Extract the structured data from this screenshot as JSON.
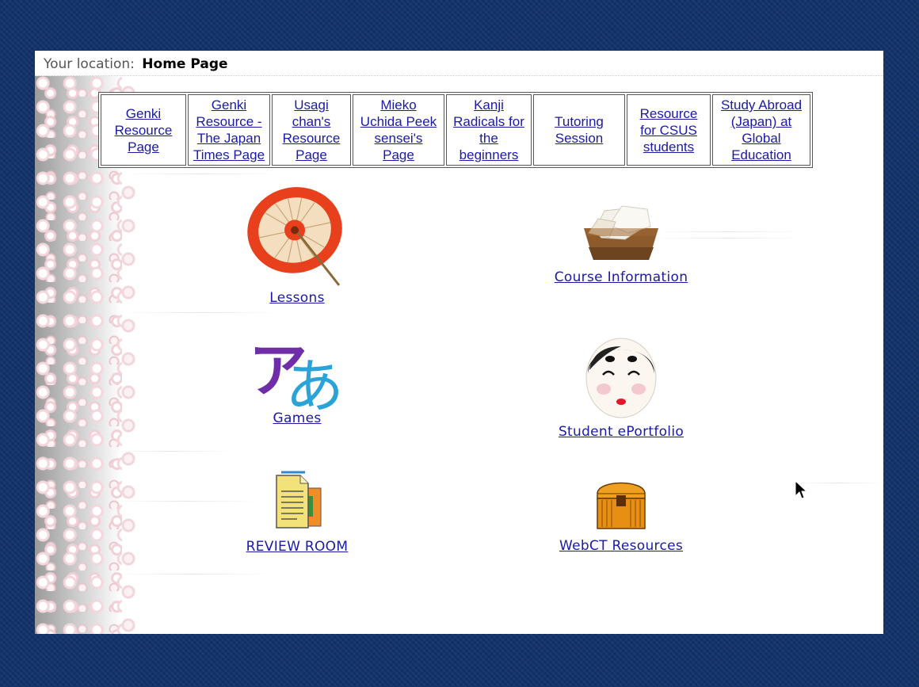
{
  "location": {
    "label": "Your location:",
    "current": "Home Page"
  },
  "nav": [
    {
      "lines": [
        "Genki",
        "Resource",
        "Page"
      ]
    },
    {
      "lines": [
        "Genki",
        "Resource -",
        "The Japan",
        "Times Page"
      ]
    },
    {
      "lines": [
        "Usagi",
        "chan's",
        "Resource",
        "Page"
      ]
    },
    {
      "lines": [
        "Mieko",
        "Uchida Peek",
        "sensei's",
        "Page"
      ]
    },
    {
      "lines": [
        "Kanji",
        "Radicals for",
        "the",
        "beginners"
      ]
    },
    {
      "lines": [
        "Tutoring",
        "Session"
      ]
    },
    {
      "lines": [
        "Resource",
        "for CSUS",
        "students"
      ]
    },
    {
      "lines": [
        "Study Abroad",
        "(Japan) at",
        "Global",
        "Education"
      ]
    }
  ],
  "items": {
    "lessons": {
      "label": "Lessons",
      "icon": "umbrella-icon"
    },
    "course_info": {
      "label": "Course Information",
      "icon": "inbox-tray-icon"
    },
    "games": {
      "label": "Games",
      "icon": "kana-icon",
      "kana_a": "ア",
      "kana_b": "あ"
    },
    "eportfolio": {
      "label": "Student ePortfolio",
      "icon": "okame-mask-icon"
    },
    "review": {
      "label": "REVIEW ROOM",
      "icon": "documents-icon"
    },
    "webct": {
      "label": "WebCT Resources",
      "icon": "treasure-chest-icon"
    }
  },
  "colors": {
    "link": "#1a1aa6",
    "frame": "#12336b",
    "umbrella": "#e8401c",
    "kana_a": "#6f2da8",
    "kana_b": "#2aa3d8"
  }
}
